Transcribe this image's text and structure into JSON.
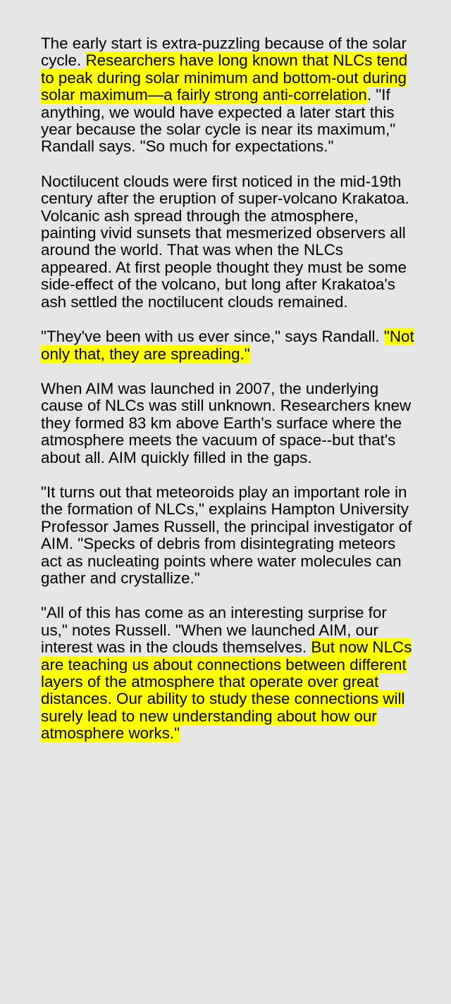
{
  "article": {
    "paragraphs": [
      {
        "segments": [
          {
            "text": "The early start is extra-puzzling because of the solar cycle.  ",
            "highlight": false
          },
          {
            "text": "Researchers have long known that NLCs tend to peak during solar minimum and bottom-out during solar maximum—a fairly strong anti-correlation",
            "highlight": true
          },
          {
            "text": ".  \"If anything, we would have expected a later start this year because the solar cycle is near its maximum,\" Randall says. \"So much for expectations.\"",
            "highlight": false
          }
        ]
      },
      {
        "segments": [
          {
            "text": "Noctilucent clouds were first noticed in the mid-19th century after the eruption of super-volcano Krakatoa. Volcanic ash spread through the atmosphere, painting vivid sunsets that mesmerized observers all around the world. That was when the NLCs appeared. At first people thought they must be some side-effect of the volcano, but long after Krakatoa's ash settled the noctilucent clouds remained.",
            "highlight": false
          }
        ]
      },
      {
        "segments": [
          {
            "text": "\"They've been with us ever since,\" says Randall.  ",
            "highlight": false
          },
          {
            "text": "\"Not only that, they are spreading.\"",
            "highlight": true
          }
        ]
      },
      {
        "segments": [
          {
            "text": "When AIM was launched in 2007, the underlying cause of NLCs was still unknown. Researchers knew they formed 83 km above Earth's surface where the atmosphere meets the vacuum of space--but that's about all.  AIM quickly filled in the gaps.",
            "highlight": false
          }
        ]
      },
      {
        "segments": [
          {
            "text": "\"It turns out that meteoroids play an important role in the formation of NLCs,\" explains Hampton University Professor James Russell, the principal investigator of AIM. \"Specks of debris from disintegrating meteors act as nucleating points where water molecules can gather and crystallize.\"",
            "highlight": false
          }
        ]
      },
      {
        "segments": [
          {
            "text": "\"All of this has come as an interesting surprise for us,\" notes Russell.  \"When we launched AIM, our interest was in the clouds themselves.  ",
            "highlight": false
          },
          {
            "text": "But now NLCs are teaching us about connections between different layers of the atmosphere that operate over great distances. Our ability to study these connections will surely lead to new understanding about how our atmosphere works.\"",
            "highlight": true
          }
        ]
      }
    ]
  },
  "colors": {
    "background": "#e6e6e6",
    "highlight": "#ffff00",
    "text": "#000000"
  }
}
